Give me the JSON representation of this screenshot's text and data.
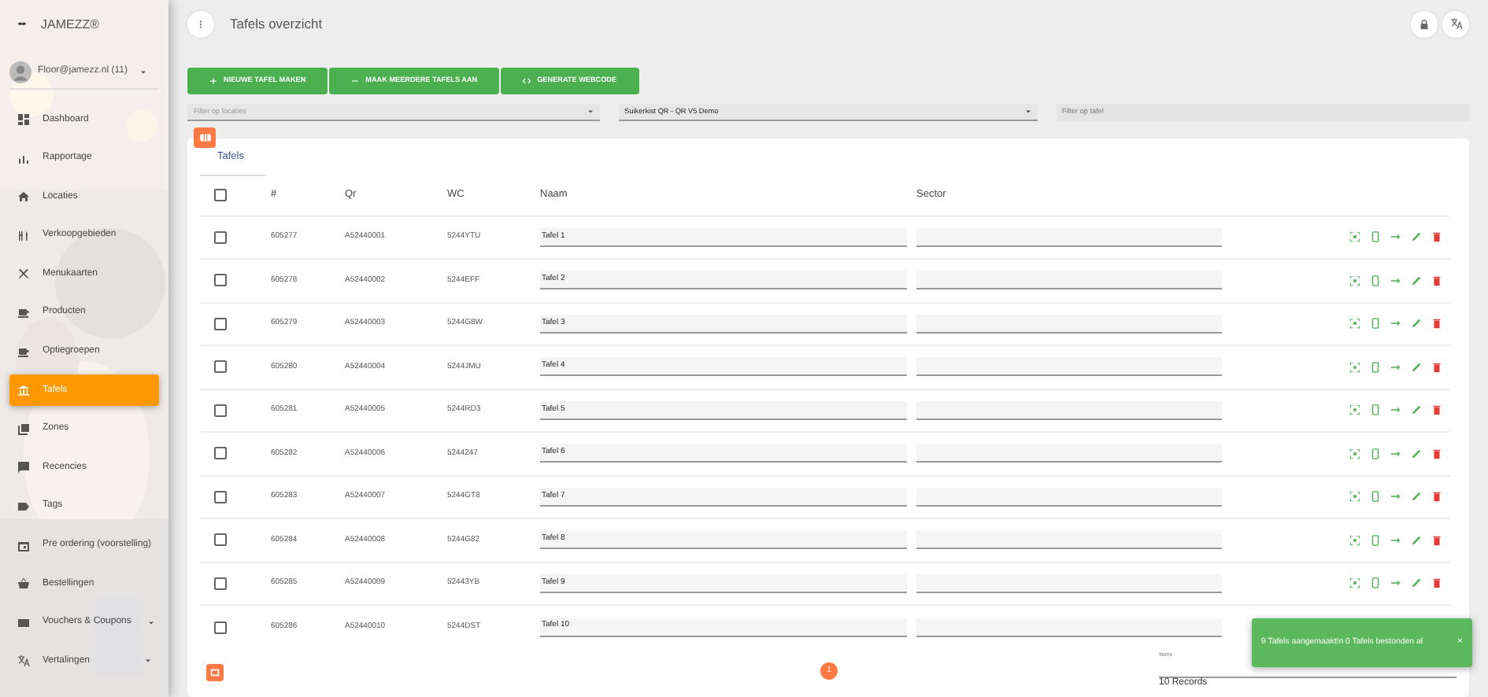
{
  "sidebar": {
    "brand": "JAMEZZ®",
    "user": "Floor@jamezz.nl (11)",
    "items": [
      {
        "label": "Dashboard",
        "kind": "dashboard",
        "selected": false,
        "caret": false
      },
      {
        "label": "Rapportage",
        "kind": "chart",
        "selected": false,
        "caret": false
      },
      {
        "label": "Locaties",
        "kind": "home",
        "selected": false,
        "caret": false
      },
      {
        "label": "Verkoopgebieden",
        "kind": "cutlery",
        "selected": false,
        "caret": false
      },
      {
        "label": "Menukaarten",
        "kind": "tools",
        "selected": false,
        "caret": false
      },
      {
        "label": "Producten",
        "kind": "cup",
        "selected": false,
        "caret": false
      },
      {
        "label": "Optiegroepen",
        "kind": "cup",
        "selected": false,
        "caret": false
      },
      {
        "label": "Tafels",
        "kind": "table",
        "selected": true,
        "caret": false
      },
      {
        "label": "Zones",
        "kind": "zones",
        "selected": false,
        "caret": false
      },
      {
        "label": "Recencies",
        "kind": "review",
        "selected": false,
        "caret": false
      },
      {
        "label": "Tags",
        "kind": "tag",
        "selected": false,
        "caret": false
      },
      {
        "label": "Pre ordering (voorstelling)",
        "kind": "calendar",
        "selected": false,
        "caret": false
      },
      {
        "label": "Bestellingen",
        "kind": "basket",
        "selected": false,
        "caret": false
      },
      {
        "label": "Vouchers & Coupons",
        "kind": "voucher",
        "selected": false,
        "caret": true
      },
      {
        "label": "Vertalingen",
        "kind": "translate",
        "selected": false,
        "caret": true
      }
    ]
  },
  "header": {
    "title": "Tafels overzicht"
  },
  "buttons": [
    {
      "kind": "plus",
      "label": "NIEUWE TAFEL MAKEN"
    },
    {
      "kind": "minus",
      "label": "MAAK MEERDERE TAFELS AAN"
    },
    {
      "kind": "code",
      "label": "GENERATE WEBCODE"
    }
  ],
  "filters": {
    "location": {
      "placeholder": "Filter op locaties"
    },
    "menu": {
      "value": "Suikerkist QR - QR V5 Demo"
    },
    "table": {
      "placeholder": "Filter op tafel"
    }
  },
  "tabs": [
    {
      "label": "Tafels",
      "selected": true
    }
  ],
  "table": {
    "all_checked": false,
    "columns": [
      "#",
      "Qr",
      "WC",
      "Naam",
      "Sector"
    ],
    "rows": [
      {
        "checked": false,
        "number": "605277",
        "qr": "A52440001",
        "wc": "5244YTU",
        "naam": "Tafel 1"
      },
      {
        "checked": false,
        "number": "605278",
        "qr": "A52440002",
        "wc": "5244EFF",
        "naam": "Tafel 2"
      },
      {
        "checked": false,
        "number": "605279",
        "qr": "A52440003",
        "wc": "5244G8W",
        "naam": "Tafel 3"
      },
      {
        "checked": false,
        "number": "605280",
        "qr": "A52440004",
        "wc": "5244JMU",
        "naam": "Tafel 4"
      },
      {
        "checked": false,
        "number": "605281",
        "qr": "A52440005",
        "wc": "5244RD3",
        "naam": "Tafel 5"
      },
      {
        "checked": false,
        "number": "605282",
        "qr": "A52440006",
        "wc": "5244247",
        "naam": "Tafel 6"
      },
      {
        "checked": false,
        "number": "605283",
        "qr": "A52440007",
        "wc": "5244GT8",
        "naam": "Tafel 7"
      },
      {
        "checked": false,
        "number": "605284",
        "qr": "A52440008",
        "wc": "5244G82",
        "naam": "Tafel 8"
      },
      {
        "checked": false,
        "number": "605285",
        "qr": "A52440009",
        "wc": "52443YB",
        "naam": "Tafel 9"
      },
      {
        "checked": false,
        "number": "605286",
        "qr": "A52440010",
        "wc": "5244DST",
        "naam": "Tafel 10"
      }
    ]
  },
  "pagination": [
    {
      "label": "1",
      "selected": true
    }
  ],
  "items_select": {
    "label": "Items",
    "value": "10 Records"
  },
  "toast": {
    "message": "9 Tafels aangemaakt!n 0 Tafels bestonden al",
    "close": "×"
  }
}
